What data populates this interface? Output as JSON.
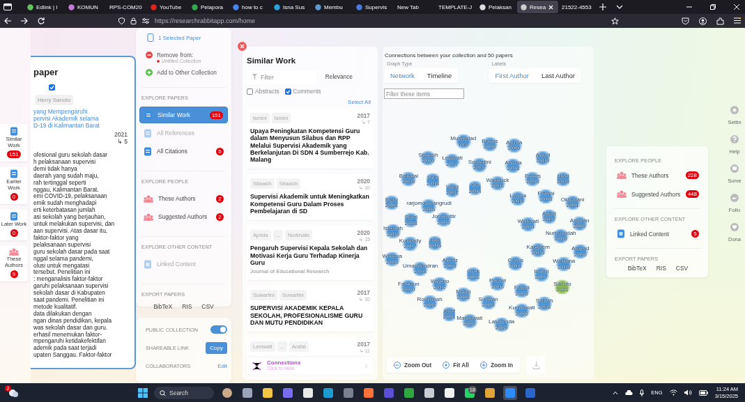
{
  "browser": {
    "tabs": [
      {
        "label": "Edlink | I",
        "selected": false
      },
      {
        "label": "KOMUN",
        "selected": false
      },
      {
        "label": "RPS-COM20",
        "selected": false
      },
      {
        "label": "YouTube",
        "selected": false
      },
      {
        "label": "Pelapora",
        "selected": false
      },
      {
        "label": "how to c",
        "selected": false
      },
      {
        "label": "Isna Sus",
        "selected": false
      },
      {
        "label": "Membu",
        "selected": false
      },
      {
        "label": "Supervis",
        "selected": false
      },
      {
        "label": "New Tab",
        "selected": false
      },
      {
        "label": "TEMPLATE-J",
        "selected": false
      },
      {
        "label": "Pelaksan",
        "selected": false
      },
      {
        "label": "Resea",
        "selected": true
      },
      {
        "label": "21522-4553",
        "selected": false
      }
    ],
    "url": "https://researchrabbitapp.com/home"
  },
  "left_strip": {
    "items": [
      {
        "kind": "papers",
        "label": "Similar Work",
        "count": "151"
      },
      {
        "kind": "papers",
        "label": "Earlier Work",
        "count": "0"
      },
      {
        "kind": "papers",
        "label": "Later Work",
        "count": "0"
      },
      {
        "kind": "people",
        "label": "These Authors",
        "count": "9"
      }
    ]
  },
  "paper": {
    "title": "paper",
    "checked": true,
    "author": "Herry Sanoto",
    "title_lines": [
      "yang Mempengaruhi",
      "pervisi Akademik selama",
      "D-19 di Kalimantan Barat"
    ],
    "year": "2021",
    "citations": "↳ 5",
    "abstract_lines": [
      "ofesional guru sekolah dasar",
      "h pelaksanaan supervisi",
      "demi tidak hanya",
      "daerah yang sudah maju,",
      "rah tertinggal seperti",
      "nggau, Kalimantan Barat.",
      "emi COVID-19, pelaksanaan",
      "emik sudah menghadapi",
      "erti keterbatasan jumlah",
      "asi sekolah yang berjauhan,",
      "untuk melakukan supervisi, dan",
      "aan supervisi. Atas dasar itu,",
      "faktor-faktor yang",
      "pelaksanaan supervisi",
      "guru sekolah dasar pada saat",
      "nggal selama pandemi,",
      "olusi untuk mengatasi",
      "tersebut. Penelitian ini",
      ": menganalisis faktor-faktor",
      "garuhi pelaksanaan supervisi",
      "sekolah dasar di Kabupaten",
      "saat pandemi. Penelitian ini",
      "metode kualitatif.",
      "data dilakukan dengan",
      "ngan dinas pendidikan, kepala",
      "was sekolah dasar dan guru.",
      "erhasil menemukan faktor-",
      "mpengaruhi ketidakefektifan",
      "ademik pada saat terjadi",
      "upaten Sanggau. Faktor-faktor"
    ]
  },
  "collection": {
    "selected_papers": "1 Selected Paper",
    "remove_label": "Remove from:",
    "collection_name": "Untitled Collection",
    "add_label": "Add to Other Collection",
    "sections": [
      {
        "heading": "EXPLORE PAPERS",
        "items": [
          {
            "kind": "papers",
            "label": "Similar Work",
            "count": "151",
            "selected": true,
            "disabled": false
          },
          {
            "kind": "papers",
            "label": "All References",
            "selected": false,
            "disabled": true
          },
          {
            "kind": "papers",
            "label": "All Citations",
            "count": "5",
            "selected": false,
            "disabled": false
          }
        ]
      },
      {
        "heading": "EXPLORE PEOPLE",
        "items": [
          {
            "kind": "people",
            "label": "These Authors",
            "count": "2",
            "selected": false,
            "disabled": false
          },
          {
            "kind": "people",
            "label": "Suggested Authors",
            "count": "2",
            "selected": false,
            "disabled": false
          }
        ]
      },
      {
        "heading": "EXPLORE OTHER CONTENT",
        "items": [
          {
            "kind": "content",
            "label": "Linked Content",
            "selected": false,
            "disabled": true
          }
        ]
      }
    ],
    "export": {
      "heading": "EXPORT PAPERS",
      "formats": [
        "BibTeX",
        "RIS",
        "CSV"
      ]
    },
    "settings": [
      {
        "kind": "toggle",
        "label": "PUBLIC COLLECTION",
        "on": true
      },
      {
        "kind": "button",
        "label": "SHAREABLE LINK",
        "action": "Copy"
      },
      {
        "kind": "link",
        "label": "COLLABORATORS",
        "action": "Edit"
      }
    ]
  },
  "similar_work": {
    "title": "Similar Work",
    "filter_placeholder": "Filter",
    "sort": "Relevance",
    "options": [
      {
        "label": "Abstracts",
        "checked": false
      },
      {
        "label": "Comments",
        "checked": true
      }
    ],
    "select_all": "Select All",
    "papers": [
      {
        "authors": [
          "Ismini",
          "Ismini"
        ],
        "year": "2017",
        "citations": "↳ 7",
        "title": "Upaya Peningkatan Kompetensi Guru dalam Menyusun Silabus dan RPP Melalui Supervisi Akademik yang Berkelanjutan Di SDN 4 Sumberrejo Kab. Malang"
      },
      {
        "authors": [
          "Sitaasih",
          "Sitaasih"
        ],
        "year": "2020",
        "citations": "↳ 10",
        "title": "Supervisi Akademik untuk Meningkatkan Kompetensi Guru Dalam Proses Pembelajaran di SD"
      },
      {
        "authors": [
          "Aprida",
          "...",
          "Nurkhalis"
        ],
        "year": "2020",
        "citations": "↳ 15",
        "title": "Pengaruh Supervisi Kepala Sekolah dan Motivasi Kerja Guru Terhadap Kinerja Guru",
        "journal": "Journal of Educational Research"
      },
      {
        "authors": [
          "Suwartini",
          "Suwartini"
        ],
        "year": "2017",
        "citations": "↳ 10",
        "title": "SUPERVISI AKADEMIK KEPALA SEKOLAH, PROFESIONALISME GURU DAN MUTU PENDIDIKAN"
      },
      {
        "authors": [
          "Leniwati",
          "...",
          "Arafat"
        ],
        "year": "2017",
        "citations": "↳ 11"
      }
    ],
    "connections": {
      "title": "Connections",
      "hint": "Click to Hide"
    }
  },
  "graph": {
    "heading": "Connections between your collection and 50 papers",
    "graph_type": {
      "label": "Graph Type",
      "options": [
        {
          "label": "Network",
          "selected": true
        },
        {
          "label": "Timeline",
          "selected": false
        }
      ]
    },
    "labels": {
      "label": "Labels",
      "options": [
        {
          "label": "First Author",
          "selected": true
        },
        {
          "label": "Last Author",
          "selected": false
        }
      ]
    },
    "filter_placeholder": "Filter these items",
    "nodes": [
      {
        "name": "Musyadad",
        "year": "null",
        "color": "#3f8fd6"
      },
      {
        "name": "Bertus",
        "year": "2019",
        "color": "#3f8fd6"
      },
      {
        "name": "Aprida",
        "year": "2020",
        "color": "#3f8fd6"
      },
      {
        "name": "Sitaasih",
        "year": "2020",
        "color": "#3f8fd6"
      },
      {
        "name": "Leniwati",
        "year": "2017",
        "color": "#3f8fd6"
      },
      {
        "name": "Suwartini",
        "year": "2017",
        "color": "#3f8fd6"
      },
      {
        "name": "Amelia",
        "year": "2018",
        "color": "#3f8fd6"
      },
      {
        "name": "Abadi",
        "year": "2019",
        "color": "#3f8fd6"
      },
      {
        "name": "Bafadal",
        "year": "2018",
        "color": "#3f8fd6"
      },
      {
        "name": "Shih",
        "year": "2018",
        "color": "#3f8fd6"
      },
      {
        "name": "Waddock",
        "year": "2016",
        "color": "#3f8fd6"
      },
      {
        "name": "Peters",
        "year": "2018",
        "color": "#3f8fd6"
      },
      {
        "name": "Hadi",
        "year": "2018",
        "color": "#3f8fd6"
      },
      {
        "name": "Ballu",
        "year": "2021",
        "color": "#3f8fd6"
      },
      {
        "name": "rarjomandiangrudi",
        "year": "2016",
        "color": "#3f8fd6"
      },
      {
        "name": "Vinet",
        "year": "2011",
        "color": "#3f8fd6"
      },
      {
        "name": "Xie",
        "year": "2014",
        "color": "#3f8fd6"
      },
      {
        "name": "Lavina",
        "year": "2014",
        "color": "#3f8fd6"
      },
      {
        "name": "Fitriani",
        "year": "2018",
        "color": "#3f8fd6"
      },
      {
        "name": "Oktaviani",
        "year": "2021",
        "color": "#3f8fd6"
      },
      {
        "name": "Sauri",
        "year": "2018",
        "color": "#3f8fd6"
      },
      {
        "name": "Jonsdottir",
        "year": "2015",
        "color": "#3f8fd6"
      },
      {
        "name": "Widavati",
        "year": "2014",
        "color": "#3f8fd6"
      },
      {
        "name": "Astuti",
        "year": "2017",
        "color": "#3f8fd6"
      },
      {
        "name": "Andrian",
        "year": "2019",
        "color": "#3f8fd6"
      },
      {
        "name": "Istianah",
        "year": "2019",
        "color": "#3f8fd6"
      },
      {
        "name": "Kurniady",
        "year": "2017",
        "color": "#3f8fd6"
      },
      {
        "name": "Hull",
        "year": "2016",
        "color": "#3f8fd6"
      },
      {
        "name": "Karsivem",
        "year": "2015",
        "color": "#3f8fd6"
      },
      {
        "name": "Nurhamidah",
        "year": "2018",
        "color": "#3f8fd6"
      },
      {
        "name": "Ahmad",
        "year": "2020",
        "color": "#3f8fd6"
      },
      {
        "name": "Wibawa",
        "year": "2019",
        "color": "#3f8fd6"
      },
      {
        "name": "Umachandran",
        "year": "2018",
        "color": "#3f8fd6"
      },
      {
        "name": "Ametz",
        "year": "2013",
        "color": "#3f8fd6"
      },
      {
        "name": "Crick",
        "year": "2011",
        "color": "#3f8fd6"
      },
      {
        "name": "Cavus",
        "year": "2011",
        "color": "#3f8fd6"
      },
      {
        "name": "Ismini",
        "year": "2017",
        "color": "#3f8fd6"
      },
      {
        "name": "Wardana",
        "year": "2018",
        "color": "#3f8fd6"
      },
      {
        "name": "Faizatun",
        "year": "2020",
        "color": "#3f8fd6"
      },
      {
        "name": "Wiyono",
        "year": "2017",
        "color": "#3f8fd6"
      },
      {
        "name": "Messi",
        "year": "2018",
        "color": "#3f8fd6"
      },
      {
        "name": "Pratiwi",
        "year": "2015",
        "color": "#3f8fd6"
      },
      {
        "name": "Fahmi",
        "year": "2018",
        "color": "#3f8fd6"
      },
      {
        "name": "Sanoto",
        "year": "2021",
        "color": "#7cb342"
      },
      {
        "name": "Rochimah",
        "year": "2018",
        "color": "#3f8fd6"
      },
      {
        "name": "Arief",
        "year": "2021",
        "color": "#3f8fd6"
      },
      {
        "name": "Marhawati",
        "year": "2020",
        "color": "#3f8fd6"
      },
      {
        "name": "Sullivan",
        "year": "2018",
        "color": "#3f8fd6"
      },
      {
        "name": "Lalupanda",
        "year": "2019",
        "color": "#3f8fd6"
      },
      {
        "name": "Kurniawati",
        "year": "2020",
        "color": "#3f8fd6"
      },
      {
        "name": "Saidah",
        "year": "2018",
        "color": "#3f8fd6"
      }
    ],
    "controls": [
      {
        "kind": "zoom_out",
        "label": "Zoom Out"
      },
      {
        "kind": "fit",
        "label": "Fit All"
      },
      {
        "kind": "zoom_in",
        "label": "Zoom In"
      }
    ]
  },
  "right_panel": {
    "sections": [
      {
        "heading": "EXPLORE PEOPLE",
        "items": [
          {
            "kind": "people",
            "label": "These Authors",
            "count": "228",
            "selected": false,
            "disabled": false
          },
          {
            "kind": "people",
            "label": "Suggested Authors",
            "count": "448",
            "selected": false,
            "disabled": false
          }
        ]
      },
      {
        "heading": "EXPLORE OTHER CONTENT",
        "items": [
          {
            "kind": "content",
            "label": "Linked Content",
            "count": "5",
            "selected": false,
            "disabled": false
          }
        ]
      }
    ],
    "export": {
      "heading": "EXPORT PAPERS",
      "formats": [
        "BibTeX",
        "RIS",
        "CSV"
      ]
    }
  },
  "rail": [
    {
      "kind": "settings",
      "label": "Settin"
    },
    {
      "kind": "help",
      "label": "Help"
    },
    {
      "kind": "survey",
      "label": "Surve"
    },
    {
      "kind": "follow",
      "label": "Follo"
    },
    {
      "kind": "donate",
      "label": "Dona"
    }
  ],
  "taskbar": {
    "weather_badge": "2",
    "search_placeholder": "Search",
    "apps": [
      {
        "kind": "photo",
        "selected": false
      },
      {
        "kind": "window",
        "selected": false
      },
      {
        "kind": "folder",
        "selected": false
      },
      {
        "kind": "copilot",
        "selected": false
      },
      {
        "kind": "store",
        "selected": false
      },
      {
        "kind": "edge",
        "selected": false
      },
      {
        "kind": "gear",
        "selected": false
      },
      {
        "kind": "firefox",
        "selected": false
      },
      {
        "kind": "purple",
        "selected": false
      },
      {
        "kind": "xbox",
        "selected": false
      },
      {
        "kind": "grey",
        "selected": false
      },
      {
        "kind": "file",
        "selected": false
      },
      {
        "kind": "whatsapp",
        "badge": "18",
        "selected": false
      },
      {
        "kind": "chrome",
        "selected": false
      },
      {
        "kind": "zoom",
        "selected": true
      },
      {
        "kind": "word",
        "selected": false
      }
    ],
    "language": "ENG",
    "time": "11:24 AM",
    "date": "3/15/2025"
  }
}
